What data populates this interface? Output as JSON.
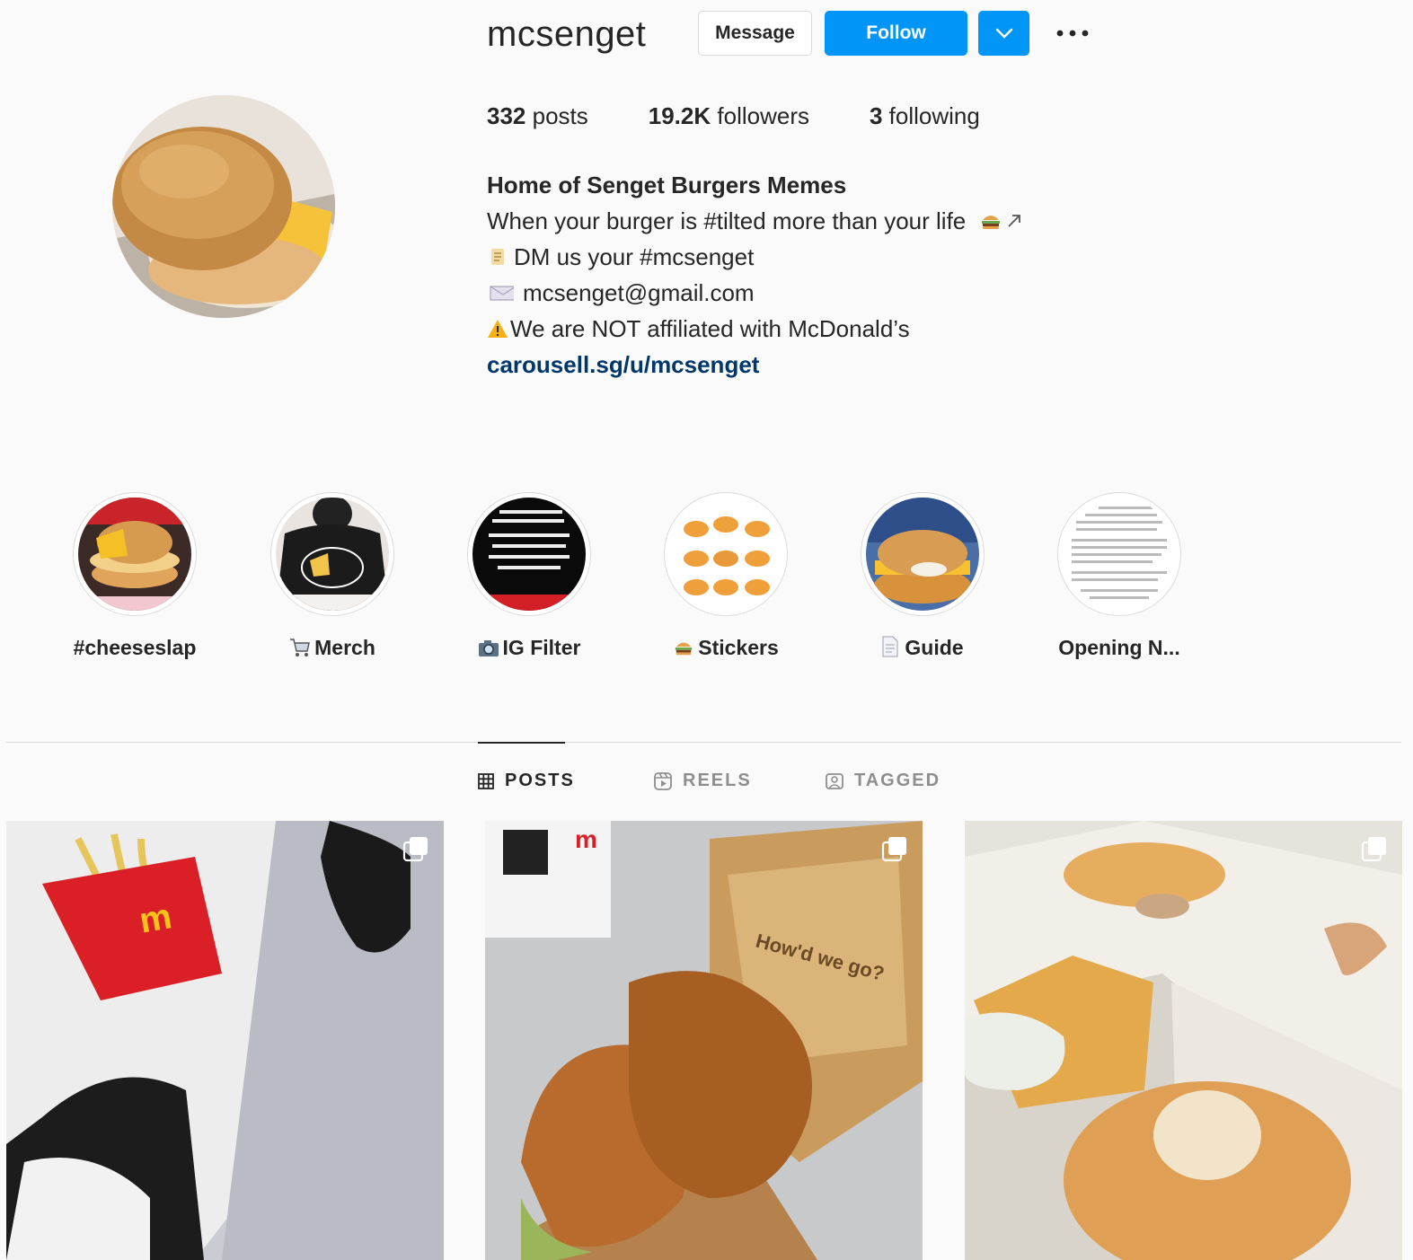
{
  "profile": {
    "username": "mcsenget",
    "message_label": "Message",
    "follow_label": "Follow",
    "stats": {
      "posts_count": "332",
      "posts_label": " posts",
      "followers_count": "19.2K",
      "followers_label": " followers",
      "following_count": "3",
      "following_label": " following"
    },
    "bio": {
      "title": "Home of Senget Burgers Memes",
      "line1": "When your burger is #tilted more than your life",
      "line2": "DM us your #mcsenget",
      "line3": "mcsenget@gmail.com",
      "line4": "We are NOT affiliated with McDonald’s",
      "link": "carousell.sg/u/mcsenget"
    }
  },
  "highlights": [
    {
      "label": "#cheeseslap",
      "icon": ""
    },
    {
      "label": "Merch",
      "icon": "cart-icon"
    },
    {
      "label": "IG Filter",
      "icon": "camera-icon"
    },
    {
      "label": "Stickers",
      "icon": "burger-icon"
    },
    {
      "label": "Guide",
      "icon": "page-icon"
    },
    {
      "label": "Opening N...",
      "icon": ""
    }
  ],
  "tabs": {
    "posts": "POSTS",
    "reels": "REELS",
    "tagged": "TAGGED"
  },
  "colors": {
    "accent": "#0095f6",
    "link": "#00376b",
    "background": "#fafafa"
  }
}
